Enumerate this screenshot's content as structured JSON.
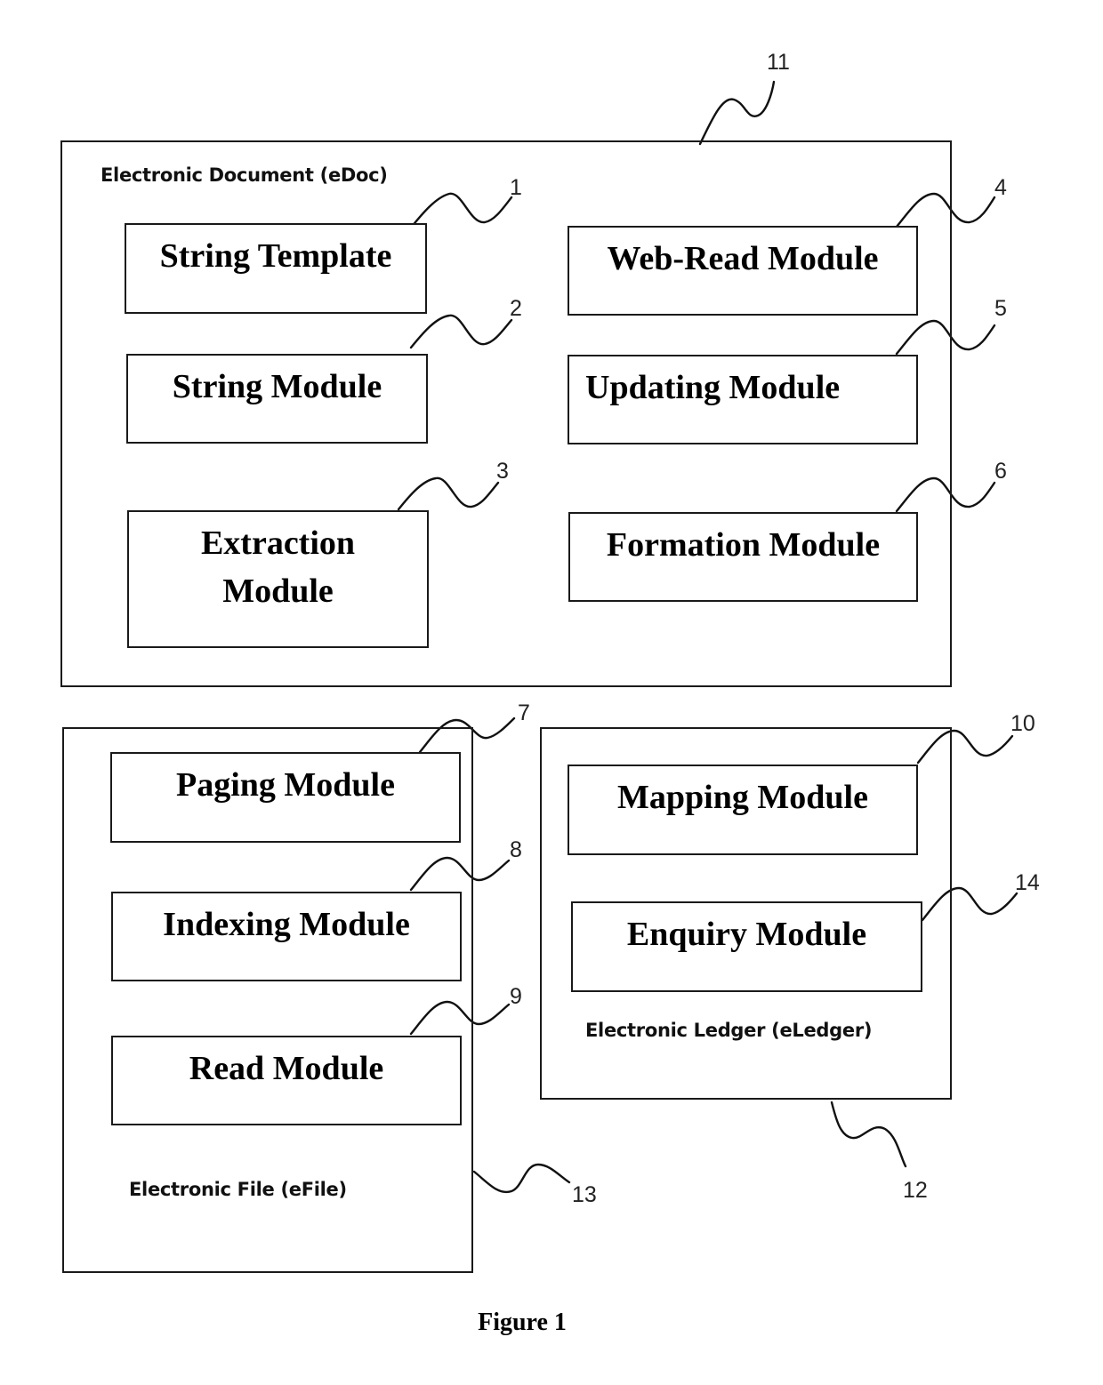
{
  "figure_caption": "Figure 1",
  "containers": {
    "edoc": {
      "label": "Electronic Document (eDoc)",
      "ref": "11"
    },
    "efile": {
      "label": "Electronic File (eFile)",
      "ref": "13"
    },
    "eledger": {
      "label": "Electronic Ledger (eLedger)",
      "ref": "12"
    }
  },
  "modules": {
    "string_template": {
      "label": "String Template",
      "ref": "1"
    },
    "string_module": {
      "label": "String Module",
      "ref": "2"
    },
    "extraction_module": {
      "label_line1": "Extraction",
      "label_line2": "Module",
      "ref": "3"
    },
    "web_read_module": {
      "label": "Web-Read Module",
      "ref": "4"
    },
    "updating_module": {
      "label": "Updating Module",
      "ref": "5"
    },
    "formation_module": {
      "label": "Formation Module",
      "ref": "6"
    },
    "paging_module": {
      "label": "Paging Module",
      "ref": "7"
    },
    "indexing_module": {
      "label": "Indexing Module",
      "ref": "8"
    },
    "read_module": {
      "label": "Read Module",
      "ref": "9"
    },
    "mapping_module": {
      "label": "Mapping Module",
      "ref": "10"
    },
    "enquiry_module": {
      "label": "Enquiry Module",
      "ref": "14"
    }
  }
}
